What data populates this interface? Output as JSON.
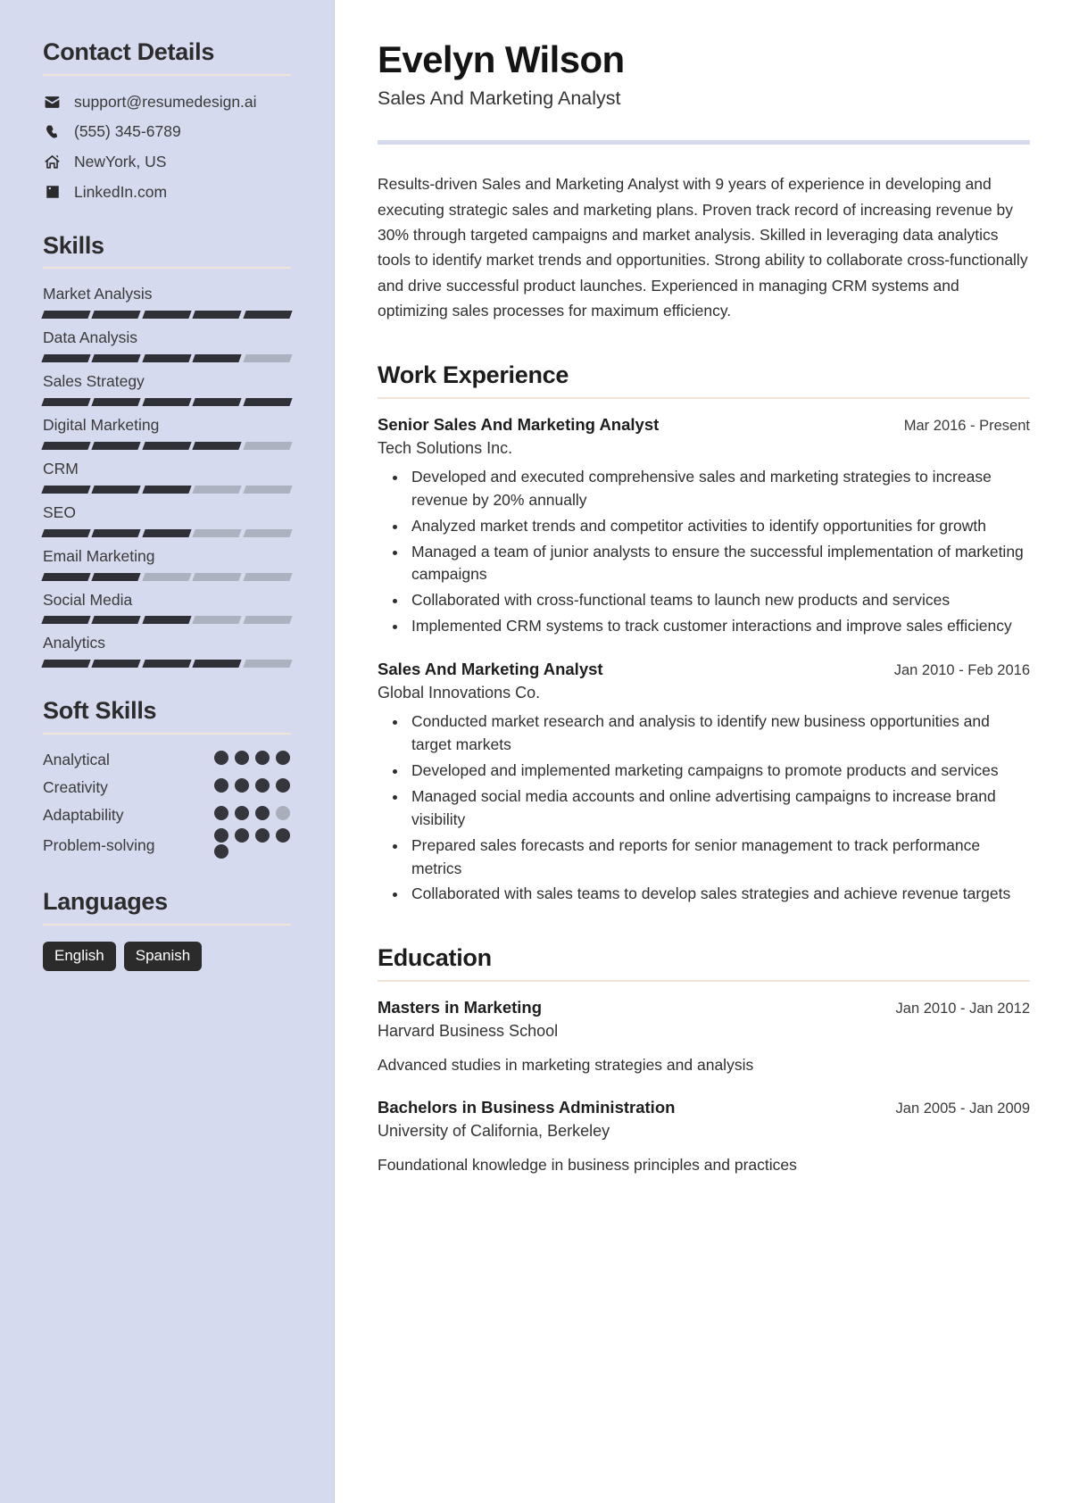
{
  "sidebar": {
    "contact": {
      "title": "Contact Details",
      "items": [
        {
          "icon": "envelope-icon",
          "value": "support@resumedesign.ai"
        },
        {
          "icon": "phone-icon",
          "value": "(555) 345-6789"
        },
        {
          "icon": "home-icon",
          "value": "NewYork, US"
        },
        {
          "icon": "linkedin-icon",
          "value": "LinkedIn.com"
        }
      ]
    },
    "skills": {
      "title": "Skills",
      "max": 5,
      "items": [
        {
          "name": "Market Analysis",
          "level": 5
        },
        {
          "name": "Data Analysis",
          "level": 4
        },
        {
          "name": "Sales Strategy",
          "level": 5
        },
        {
          "name": "Digital Marketing",
          "level": 4
        },
        {
          "name": "CRM",
          "level": 3
        },
        {
          "name": "SEO",
          "level": 3
        },
        {
          "name": "Email Marketing",
          "level": 2
        },
        {
          "name": "Social Media",
          "level": 3
        },
        {
          "name": "Analytics",
          "level": 4
        }
      ]
    },
    "soft_skills": {
      "title": "Soft Skills",
      "max": 4,
      "items": [
        {
          "name": "Analytical",
          "level": 4
        },
        {
          "name": "Creativity",
          "level": 4
        },
        {
          "name": "Adaptability",
          "level": 3
        },
        {
          "name": "Problem-solving",
          "level": 4
        }
      ]
    },
    "languages": {
      "title": "Languages",
      "items": [
        "English",
        "Spanish"
      ]
    }
  },
  "main": {
    "name": "Evelyn Wilson",
    "role": "Sales And Marketing Analyst",
    "summary": "Results-driven Sales and Marketing Analyst with 9 years of experience in developing and executing strategic sales and marketing plans. Proven track record of increasing revenue by 30% through targeted campaigns and market analysis. Skilled in leveraging data analytics tools to identify market trends and opportunities. Strong ability to collaborate cross-functionally and drive successful product launches. Experienced in managing CRM systems and optimizing sales processes for maximum efficiency.",
    "work": {
      "title": "Work Experience",
      "entries": [
        {
          "title": "Senior Sales And Marketing Analyst",
          "date": "Mar 2016 - Present",
          "org": "Tech Solutions Inc.",
          "bullets": [
            "Developed and executed comprehensive sales and marketing strategies to increase revenue by 20% annually",
            "Analyzed market trends and competitor activities to identify opportunities for growth",
            "Managed a team of junior analysts to ensure the successful implementation of marketing campaigns",
            "Collaborated with cross-functional teams to launch new products and services",
            "Implemented CRM systems to track customer interactions and improve sales efficiency"
          ]
        },
        {
          "title": "Sales And Marketing Analyst",
          "date": "Jan 2010 - Feb 2016",
          "org": "Global Innovations Co.",
          "bullets": [
            "Conducted market research and analysis to identify new business opportunities and target markets",
            "Developed and implemented marketing campaigns to promote products and services",
            "Managed social media accounts and online advertising campaigns to increase brand visibility",
            "Prepared sales forecasts and reports for senior management to track performance metrics",
            "Collaborated with sales teams to develop sales strategies and achieve revenue targets"
          ]
        }
      ]
    },
    "education": {
      "title": "Education",
      "entries": [
        {
          "title": "Masters in Marketing",
          "date": "Jan 2010 - Jan 2012",
          "org": "Harvard Business School",
          "desc": "Advanced studies in marketing strategies and analysis"
        },
        {
          "title": "Bachelors in Business Administration",
          "date": "Jan 2005 - Jan 2009",
          "org": "University of California, Berkeley",
          "desc": "Foundational knowledge in business principles and practices"
        }
      ]
    }
  },
  "colors": {
    "sidebar_bg": "#d5daee",
    "rule": "#f0e4d6",
    "accent_bar": "#d5daee",
    "filled": "#2f3136",
    "empty": "#adb2c0",
    "tag_bg": "#2b2b2b"
  }
}
